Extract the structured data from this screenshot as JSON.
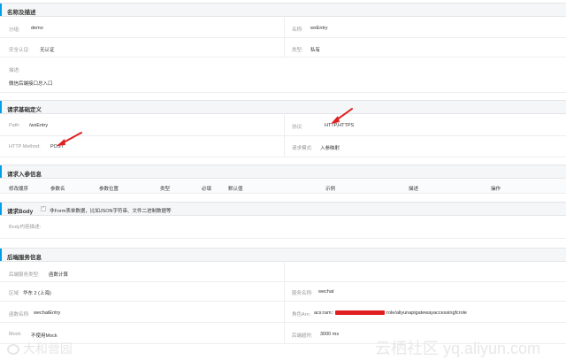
{
  "sec_name": {
    "title": "名称及描述",
    "group_label": "分组:",
    "group_value": "demo",
    "name_label": "名称:",
    "name_value": "wxEntry",
    "auth_label": "安全认证:",
    "auth_value": "无认证",
    "type_label": "类型:",
    "type_value": "私有",
    "desc_label": "描述:",
    "desc_value": "微信后端接口总入口"
  },
  "sec_request": {
    "title": "请求基础定义",
    "path_label": "Path:",
    "path_value": "/wxEntry",
    "protocol_label": "协议:",
    "protocol_value": "HTTP,HTTPS",
    "method_label": "HTTP Method:",
    "method_value": "POST",
    "mode_label": "请求模式:",
    "mode_value": "入参映射"
  },
  "sec_params": {
    "title": "请求入参信息",
    "columns": [
      "修改顺序",
      "参数名",
      "参数位置",
      "类型",
      "必填",
      "默认值",
      "示例",
      "描述",
      "操作"
    ]
  },
  "sec_body": {
    "title": "请求Body",
    "checkbox_text": "非Form表单数据，比如JSON字符串、文件二进制数据等",
    "body_label": "Body内容描述:"
  },
  "sec_backend": {
    "title": "后端服务信息",
    "service_type_label": "后端服务类型:",
    "service_type_value": "函数计算",
    "region_label": "区域",
    "region_value": "华东 2 (上海)",
    "service_name_label": "服务名称:",
    "service_name_value": "wechat",
    "func_name_label": "函数名称:",
    "func_name_value": "wechatEntry",
    "role_label": "角色Arn:",
    "role_prefix": "acs:ram::",
    "role_suffix": ":role/aliyunapigatewayaccessingfcrole",
    "mock_label": "Mock:",
    "mock_value": "不使用Mock",
    "timeout_label": "后端超时:",
    "timeout_value": "3000 ms"
  },
  "watermark": {
    "left": "大和营园",
    "right": "云栖社区 yq.aliyun.com"
  }
}
